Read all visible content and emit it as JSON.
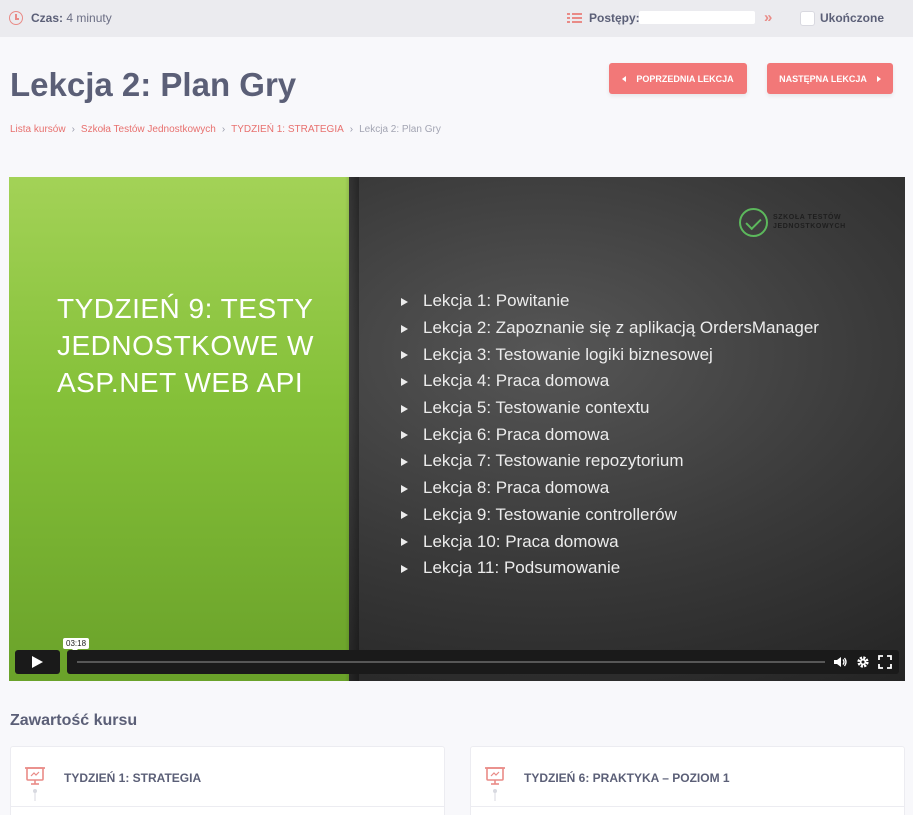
{
  "topbar": {
    "time_label": "Czas:",
    "time_value": "4 minuty",
    "progress_label": "Postępy:",
    "progress_fraction": 0,
    "completed_label": "Ukończone",
    "completed_checked": false
  },
  "page": {
    "title": "Lekcja 2: Plan Gry",
    "prev_button": "POPRZEDNIA LEKCJA",
    "next_button": "NASTĘPNA LEKCJA"
  },
  "breadcrumb": [
    "Lista kursów",
    "Szkoła Testów Jednostkowych",
    "TYDZIEŃ 1: STRATEGIA",
    "Lekcja 2: Plan Gry"
  ],
  "video": {
    "slide_title": "TYDZIEŃ 9: TESTY JEDNOSTKOWE W ASP.NET WEB API",
    "logo_line1": "SZKOŁA TESTÓW",
    "logo_line2": "JEDNOSTKOWYCH",
    "lessons": [
      "Lekcja 1: Powitanie",
      "Lekcja 2: Zapoznanie się z aplikacją OrdersManager",
      "Lekcja 3: Testowanie logiki biznesowej",
      "Lekcja 4: Praca domowa",
      "Lekcja 5: Testowanie contextu",
      "Lekcja 6: Praca domowa",
      "Lekcja 7: Testowanie repozytorium",
      "Lekcja 8: Praca domowa",
      "Lekcja 9: Testowanie controllerów",
      "Lekcja 10: Praca domowa",
      "Lekcja 11: Podsumowanie"
    ],
    "duration": "03:18"
  },
  "course_content": {
    "heading": "Zawartość kursu",
    "cards": [
      "TYDZIEŃ 1: STRATEGIA",
      "TYDZIEŃ 6: PRAKTYKA – POZIOM 1"
    ]
  },
  "colors": {
    "accent": "#f27878",
    "accent_text": "#e8716f",
    "text_dark": "#5b5f77",
    "slide_green": "#84c038",
    "logo_green": "#5cb85c"
  }
}
